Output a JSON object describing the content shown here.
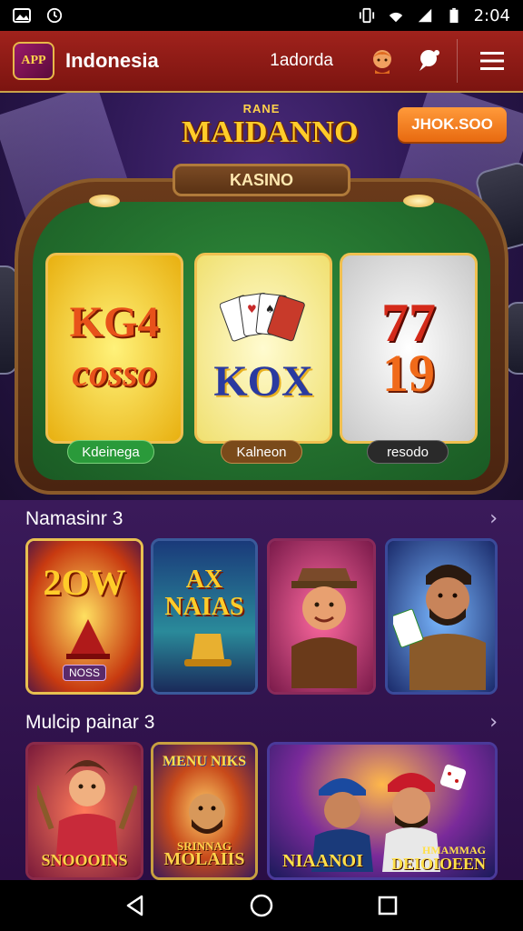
{
  "status_bar": {
    "time": "2:04"
  },
  "app_bar": {
    "logo_text": "APP",
    "title": "Indonesia",
    "link": "1adorda"
  },
  "hero": {
    "brand_top": "RANE",
    "brand": "MAIDANNO",
    "promo_button": "JHOK.SOO",
    "table_label": "KASINO",
    "slots": [
      {
        "line1": "KG4",
        "line2": "cosso",
        "pill": "Kdeinega"
      },
      {
        "line1": "KOX",
        "pill": "Kalneon"
      },
      {
        "line1": "77",
        "line2": "19",
        "pill": "resodo"
      }
    ]
  },
  "sections": [
    {
      "title": "Namasinr 3",
      "tiles": [
        {
          "big": "2OW",
          "tag": "NOSS"
        },
        {
          "big": "AX NAIAS"
        },
        {
          "big": ""
        },
        {
          "big": ""
        }
      ]
    },
    {
      "title": "Mulcip painar 3",
      "tiles": [
        {
          "caption": "SNOOOINS"
        },
        {
          "top": "MENU NIKS",
          "caption": "MOLAIIS",
          "sub": "SRINNAG"
        },
        {
          "caption_left": "NIAANOI",
          "caption_right": "DEIOIOEEN",
          "sub_right": "HMAMMAG"
        }
      ]
    }
  ],
  "colors": {
    "accent": "#a0221c",
    "gold": "#ffcc2a",
    "felt": "#2e8a3a"
  }
}
